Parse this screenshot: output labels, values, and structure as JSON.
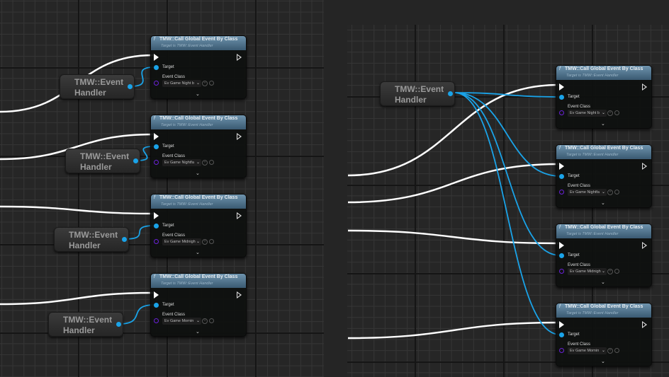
{
  "node_title": "TMW::Call Global Event By Class",
  "node_subtitle": "Target is TMW::Event Handler",
  "target_label": "Target",
  "event_class_label": "Event Class",
  "event_handler_label": "TMW::Event Handler",
  "function_icon": "f",
  "expand_icon": "⌄",
  "left_panel": {
    "nodes": [
      {
        "event_class": "Ev Game Night b"
      },
      {
        "event_class": "Ev Game Nightfa"
      },
      {
        "event_class": "Ev Game Midnigh"
      },
      {
        "event_class": "Ev Game Mornin"
      }
    ]
  },
  "right_panel": {
    "nodes": [
      {
        "event_class": "Ev Game Night b"
      },
      {
        "event_class": "Ev Game Nightfa"
      },
      {
        "event_class": "Ev Game Midnigh"
      },
      {
        "event_class": "Ev Game Mornin"
      }
    ]
  },
  "colors": {
    "exec_wire": "#ffffff",
    "object_wire": "#1aa3e8",
    "class_pin": "#6a22d8",
    "header": "#4f7590"
  }
}
